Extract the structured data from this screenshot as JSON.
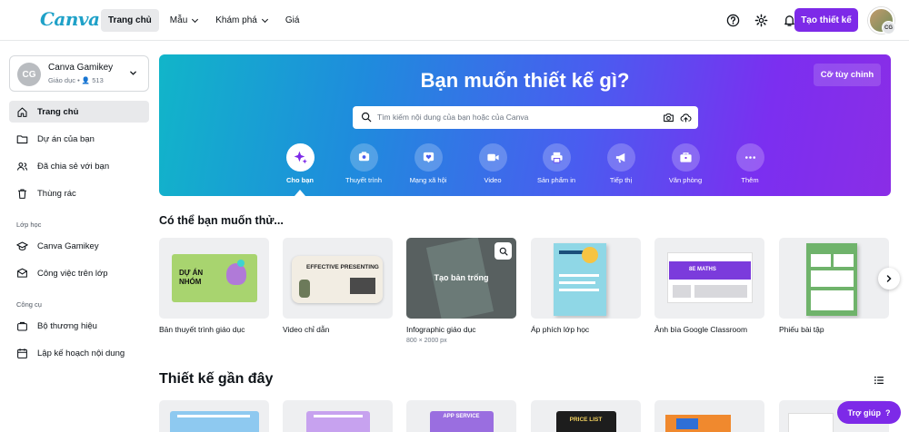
{
  "app": {
    "logo": "Canva",
    "accent": "#7d2ae8"
  },
  "nav": {
    "home": "Trang chủ",
    "templates": "Mẫu",
    "discover": "Khám phá",
    "pricing": "Giá",
    "create_button": "Tạo thiết kế",
    "avatar_initials": "CG"
  },
  "sidebar": {
    "account": {
      "initials": "CG",
      "name": "Canva Gamikey",
      "subtitle": "Giáo dục • 👤 513"
    },
    "main_items": [
      {
        "label": "Trang chủ",
        "icon": "home-icon"
      },
      {
        "label": "Dự án của bạn",
        "icon": "folder-icon"
      },
      {
        "label": "Đã chia sẻ với bạn",
        "icon": "shared-users-icon"
      },
      {
        "label": "Thùng rác",
        "icon": "trash-icon"
      }
    ],
    "class_heading": "Lớp học",
    "class_items": [
      {
        "label": "Canva Gamikey",
        "icon": "class-icon"
      },
      {
        "label": "Công việc trên lớp",
        "icon": "assignment-icon"
      }
    ],
    "tools_heading": "Công cụ",
    "tool_items": [
      {
        "label": "Bộ thương hiệu",
        "icon": "brand-kit-icon"
      },
      {
        "label": "Lập kế hoạch nội dung",
        "icon": "calendar-icon"
      }
    ]
  },
  "hero": {
    "title": "Bạn muốn thiết kế gì?",
    "custom_size": "Cỡ tùy chỉnh",
    "search_placeholder": "Tìm kiếm nội dung của bạn hoặc của Canva",
    "categories": [
      {
        "label": "Cho bạn",
        "icon": "sparkle-icon"
      },
      {
        "label": "Thuyết trình",
        "icon": "presentation-icon"
      },
      {
        "label": "Mạng xã hội",
        "icon": "heart-icon"
      },
      {
        "label": "Video",
        "icon": "video-icon"
      },
      {
        "label": "Sản phẩm in",
        "icon": "printer-icon"
      },
      {
        "label": "Tiếp thị",
        "icon": "megaphone-icon"
      },
      {
        "label": "Văn phòng",
        "icon": "briefcase-icon"
      },
      {
        "label": "Thêm",
        "icon": "more-icon"
      }
    ]
  },
  "suggestions": {
    "title": "Có thể bạn muốn thử...",
    "items": [
      {
        "label": "Bản thuyết trình giáo dục",
        "thumb_text": "DỰ ÁN NHÓM"
      },
      {
        "label": "Video chỉ dẫn",
        "thumb_text": "EFFECTIVE PRESENTING"
      },
      {
        "label": "Infographic giáo dục",
        "hover_text": "Tạo bản trống",
        "size": "800 × 2000 px"
      },
      {
        "label": "Áp phích lớp học"
      },
      {
        "label": "Ảnh bìa Google Classroom",
        "thumb_text": "8E MATHS"
      },
      {
        "label": "Phiếu bài tập"
      }
    ]
  },
  "recent": {
    "title": "Thiết kế gần đây",
    "items": [
      {
        "thumb_text": ""
      },
      {
        "thumb_text": ""
      },
      {
        "thumb_text": "APP SERVICE"
      },
      {
        "thumb_text": "PRICE LIST"
      },
      {
        "thumb_text": ""
      },
      {
        "thumb_text": ""
      }
    ]
  },
  "help": {
    "label": "Trợ giúp",
    "icon_text": "?"
  }
}
